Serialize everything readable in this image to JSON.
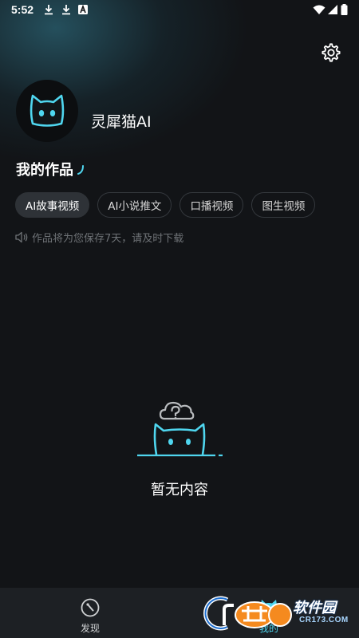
{
  "status_bar": {
    "time": "5:52",
    "left_icons": [
      "download-icon",
      "download-icon",
      "text-a-icon"
    ],
    "right_icons": [
      "wifi-icon",
      "signal-icon",
      "battery-icon"
    ]
  },
  "header": {
    "settings_icon": "gear-icon"
  },
  "profile": {
    "username": "灵犀猫AI",
    "avatar_icon": "cat-face-icon"
  },
  "works": {
    "title": "我的作品",
    "tabs": [
      {
        "label": "AI故事视频",
        "active": true
      },
      {
        "label": "AI小说推文",
        "active": false
      },
      {
        "label": "口播视频",
        "active": false
      },
      {
        "label": "图生视频",
        "active": false
      }
    ],
    "notice_icon": "speaker-icon",
    "notice": "作品将为您保存7天，请及时下载"
  },
  "empty_state": {
    "text": "暂无内容",
    "icon": "cat-cloud-question-icon"
  },
  "bottom_nav": {
    "items": [
      {
        "label": "发现",
        "icon": "compass-icon",
        "active": false
      },
      {
        "label": "我的",
        "icon": "cat-icon",
        "active": true
      }
    ]
  },
  "watermark": {
    "name": "软件园",
    "url": "CR173.COM"
  },
  "colors": {
    "accent": "#4fd6ef",
    "background": "#121417",
    "tab_active_bg": "#2e3237",
    "nav_bg": "#1d2024"
  }
}
